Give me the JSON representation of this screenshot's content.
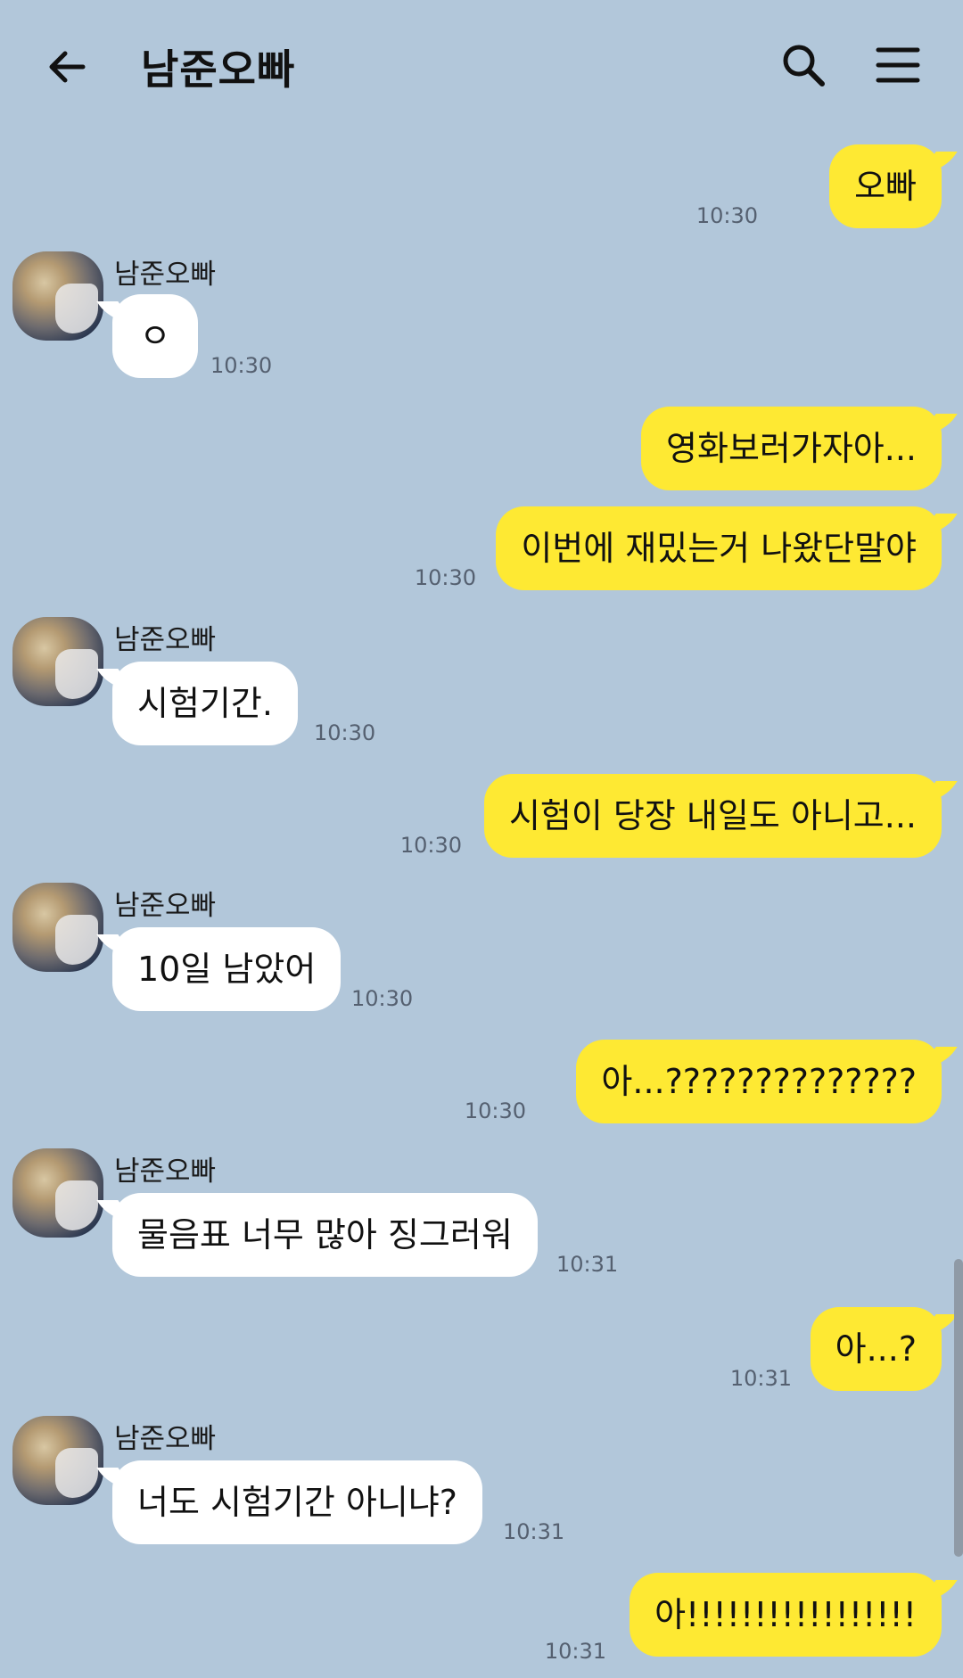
{
  "header": {
    "title": "남준오빠",
    "back_icon": "arrow-left-icon",
    "search_icon": "search-icon",
    "menu_icon": "hamburger-menu-icon"
  },
  "colors": {
    "background": "#b2c7da",
    "outgoing_bubble": "#fee933",
    "incoming_bubble": "#ffffff"
  },
  "messages": [
    {
      "direction": "out",
      "text": "오빠",
      "time": "10:30"
    },
    {
      "direction": "in",
      "sender": "남준오빠",
      "text": "ㅇ",
      "time": "10:30"
    },
    {
      "direction": "out",
      "text": "영화보러가자아...",
      "time": ""
    },
    {
      "direction": "out",
      "text": "이번에 재밌는거 나왔단말야",
      "time": "10:30"
    },
    {
      "direction": "in",
      "sender": "남준오빠",
      "text": "시험기간.",
      "time": "10:30"
    },
    {
      "direction": "out",
      "text": "시험이 당장 내일도 아니고...",
      "time": "10:30"
    },
    {
      "direction": "in",
      "sender": "남준오빠",
      "text": "10일 남았어",
      "time": "10:30"
    },
    {
      "direction": "out",
      "text": "아...??????????????",
      "time": "10:30"
    },
    {
      "direction": "in",
      "sender": "남준오빠",
      "text": "물음표 너무 많아 징그러워",
      "time": "10:31"
    },
    {
      "direction": "out",
      "text": "아...?",
      "time": "10:31"
    },
    {
      "direction": "in",
      "sender": "남준오빠",
      "text": "너도 시험기간 아니냐?",
      "time": "10:31"
    },
    {
      "direction": "out",
      "text": "아!!!!!!!!!!!!!!!!!",
      "time": "10:31"
    }
  ]
}
